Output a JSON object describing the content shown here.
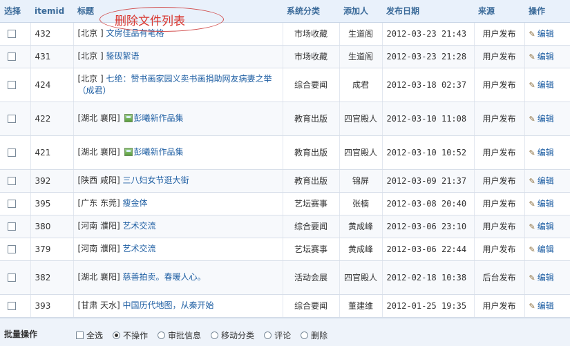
{
  "headers": {
    "select": "选择",
    "itemid": "itemid",
    "title": "标题",
    "category": "系统分类",
    "added_by": "添加人",
    "date": "发布日期",
    "source": "来源",
    "operation": "操作"
  },
  "annotation": "删除文件列表",
  "rows": [
    {
      "id": "432",
      "region": "[北京 ]",
      "title": "文房佳品有笔格",
      "has_image": false,
      "category": "市场收藏",
      "added_by": "生道阁",
      "date": "2012-03-23 21:43",
      "source": "用户发布",
      "edit": "编辑"
    },
    {
      "id": "431",
      "region": "[北京 ]",
      "title": "鉴砚絮语",
      "has_image": false,
      "category": "市场收藏",
      "added_by": "生道阁",
      "date": "2012-03-23 21:28",
      "source": "用户发布",
      "edit": "编辑"
    },
    {
      "id": "424",
      "region": "[北京 ]",
      "title": "七绝：赞书画家园义卖书画捐助网友病妻之举（成君）",
      "has_image": false,
      "category": "综合要闻",
      "added_by": "成君",
      "date": "2012-03-18 02:37",
      "source": "用户发布",
      "edit": "编辑"
    },
    {
      "id": "422",
      "region": "[湖北  襄阳]",
      "title": "彭曦新作品集",
      "has_image": true,
      "category": "教育出版",
      "added_by": "四官殿人",
      "date": "2012-03-10 11:08",
      "source": "用户发布",
      "edit": "编辑"
    },
    {
      "id": "421",
      "region": "[湖北  襄阳]",
      "title": "彭曦新作品集",
      "has_image": true,
      "category": "教育出版",
      "added_by": "四官殿人",
      "date": "2012-03-10 10:52",
      "source": "用户发布",
      "edit": "编辑"
    },
    {
      "id": "392",
      "region": "[陕西  咸阳]",
      "title": "三八妇女节逛大街",
      "has_image": false,
      "category": "教育出版",
      "added_by": "锦屏",
      "date": "2012-03-09 21:37",
      "source": "用户发布",
      "edit": "编辑"
    },
    {
      "id": "395",
      "region": "[广东  东莞]",
      "title": "瘦金体",
      "has_image": false,
      "category": "艺坛赛事",
      "added_by": "张楠",
      "date": "2012-03-08 20:40",
      "source": "用户发布",
      "edit": "编辑"
    },
    {
      "id": "380",
      "region": "[河南  濮阳]",
      "title": "艺术交流",
      "has_image": false,
      "category": "综合要闻",
      "added_by": "黄成峰",
      "date": "2012-03-06 23:10",
      "source": "用户发布",
      "edit": "编辑"
    },
    {
      "id": "379",
      "region": "[河南  濮阳]",
      "title": "艺术交流",
      "has_image": false,
      "category": "艺坛赛事",
      "added_by": "黄成峰",
      "date": "2012-03-06 22:44",
      "source": "用户发布",
      "edit": "编辑"
    },
    {
      "id": "382",
      "region": "[湖北  襄阳]",
      "title": "慈善拍卖。春暖人心。",
      "has_image": false,
      "category": "活动会展",
      "added_by": "四官殿人",
      "date": "2012-02-18 10:38",
      "source": "后台发布",
      "edit": "编辑"
    },
    {
      "id": "393",
      "region": "[甘肃  天水]",
      "title": "中国历代地图，从秦开始",
      "has_image": false,
      "category": "综合要闻",
      "added_by": "董建维",
      "date": "2012-01-25 19:35",
      "source": "用户发布",
      "edit": "编辑"
    }
  ],
  "batch": {
    "label": "批量操作",
    "select_all": "全选",
    "options": [
      "不操作",
      "审批信息",
      "移动分类",
      "评论",
      "删除"
    ],
    "selected": "不操作"
  }
}
